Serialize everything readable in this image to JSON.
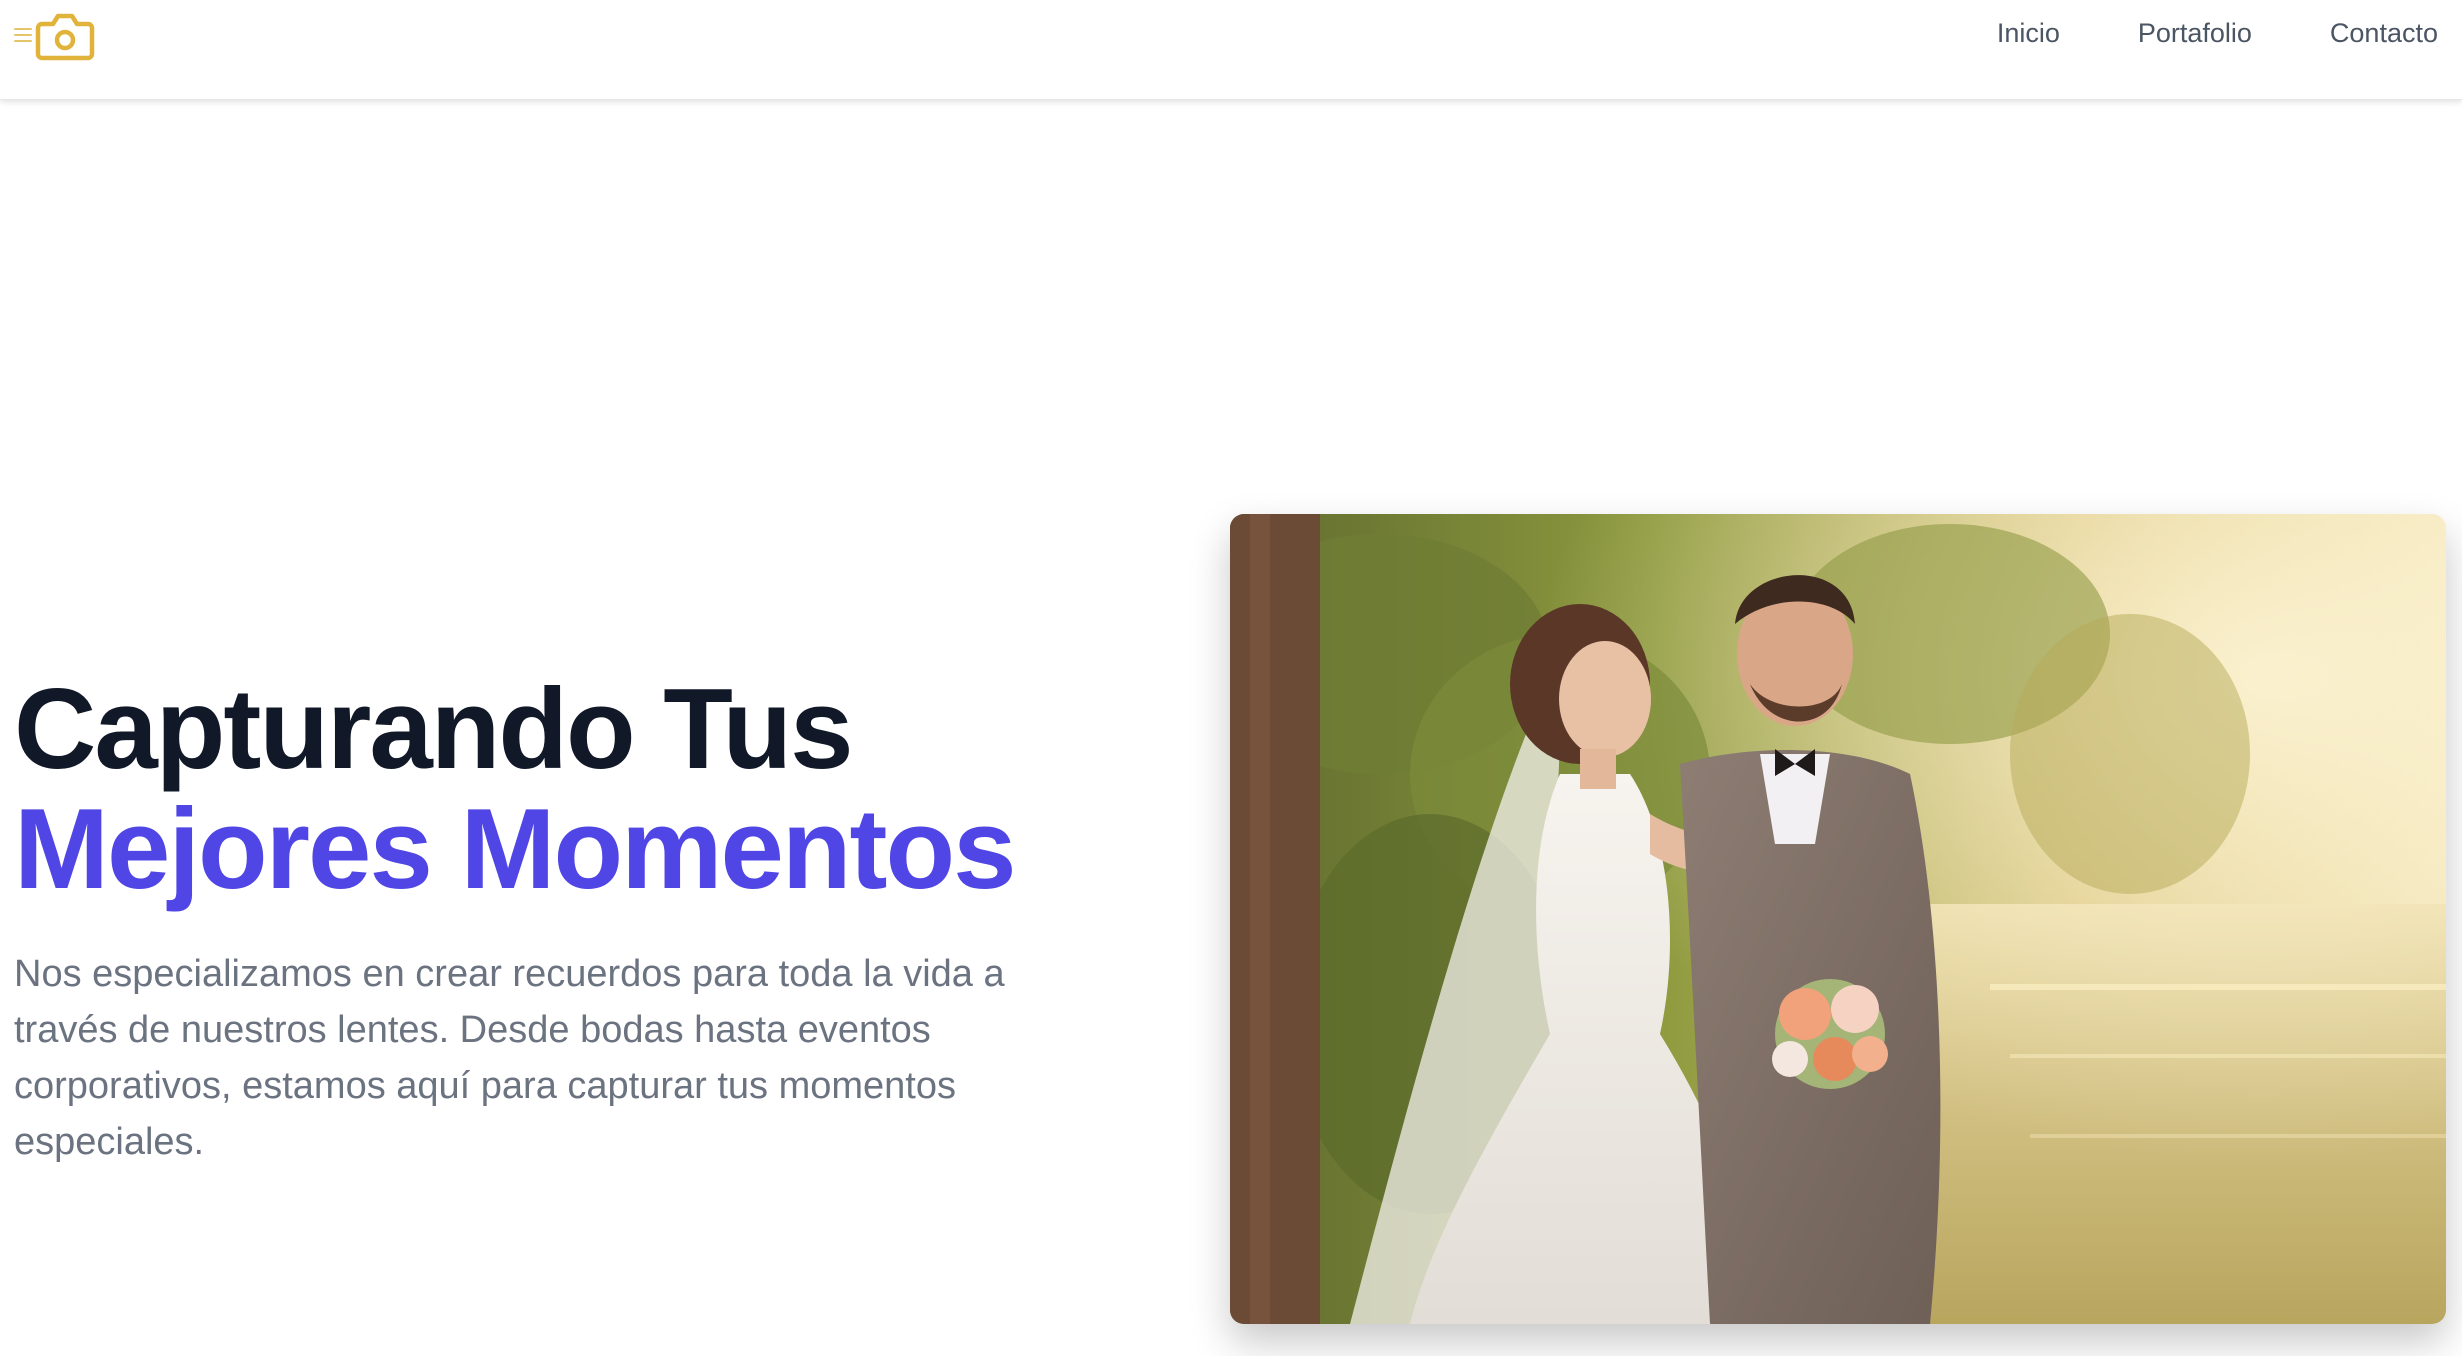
{
  "nav": {
    "logo_icon": "camera-icon",
    "menu_icon": "hamburger-menu-icon",
    "links": [
      {
        "label": "Inicio"
      },
      {
        "label": "Portafolio"
      },
      {
        "label": "Contacto"
      }
    ]
  },
  "hero": {
    "title_line1": "Capturando Tus",
    "title_line2": "Mejores Momentos",
    "description": "Nos especializamos en crear recuerdos para toda la vida a través de nuestros lentes. Desde bodas hasta eventos corporativos, estamos aquí para capturar tus momentos especiales.",
    "image_alt": "wedding-couple-photo"
  },
  "colors": {
    "accent": "#4f46e5",
    "heading": "#111827",
    "body_text": "#6b7280",
    "logo": "#e0b43a"
  }
}
